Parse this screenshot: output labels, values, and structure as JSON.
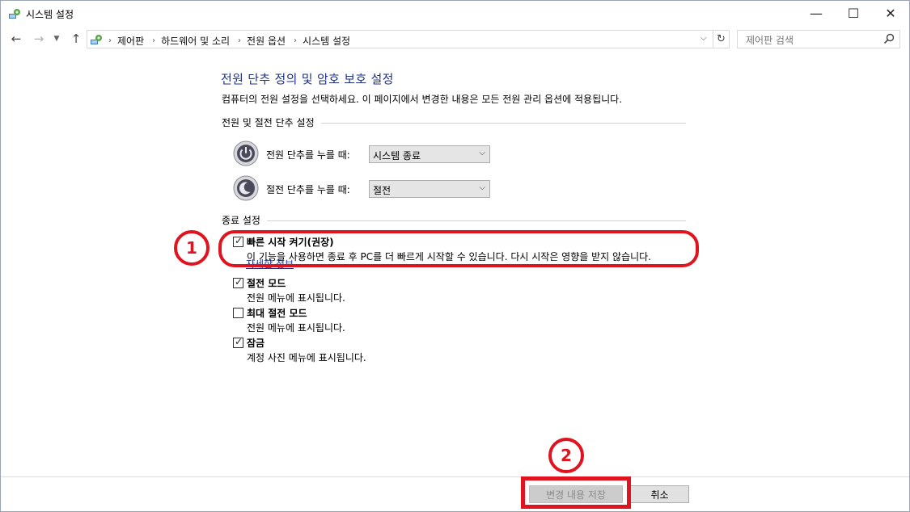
{
  "window": {
    "title": "시스템 설정",
    "controls": {
      "minimize": "—",
      "maximize": "☐",
      "close": "✕"
    }
  },
  "nav": {
    "back": "←",
    "forward": "→",
    "recent": "⌄",
    "up": "↑",
    "breadcrumb": [
      "제어판",
      "하드웨어 및 소리",
      "전원 옵션",
      "시스템 설정"
    ],
    "breadcrumb_separator": "›",
    "address_dropdown": "⌄",
    "refresh": "↻",
    "search_placeholder": "제어판 검색"
  },
  "main": {
    "heading": "전원 단추 정의 및 암호 보호 설정",
    "description": "컴퓨터의 전원 설정을 선택하세요. 이 페이지에서 변경한 내용은 모든 전원 관리 옵션에 적용됩니다.",
    "power_section_label": "전원 및 절전 단추 설정",
    "power_button": {
      "label": "전원 단추를 누를 때:",
      "value": "시스템 종료"
    },
    "sleep_button": {
      "label": "절전 단추를 누를 때:",
      "value": "절전"
    },
    "shutdown_section_label": "종료 설정",
    "options": [
      {
        "title": "빠른 시작 켜기(권장)",
        "description": "이 기능을 사용하면 종료 후 PC를 더 빠르게 시작할 수 있습니다. 다시 시작은 영향을 받지 않습니다.",
        "checked": true
      },
      {
        "title": "절전 모드",
        "description": "전원 메뉴에 표시됩니다.",
        "checked": true
      },
      {
        "title": "최대 절전 모드",
        "description": "전원 메뉴에 표시됩니다.",
        "checked": false
      },
      {
        "title": "잠금",
        "description": "계정 사진 메뉴에 표시됩니다.",
        "checked": true
      }
    ],
    "more_info_link": "자세한 정보",
    "check_mark": "✓"
  },
  "footer": {
    "save_label": "변경 내용 저장",
    "save_enabled": false,
    "cancel_label": "취소"
  },
  "annotations": {
    "marker_1": "1",
    "marker_2": "2",
    "color": "#e0141e"
  },
  "colors": {
    "heading": "#1e3287",
    "link": "#1e3287"
  },
  "icons": {
    "app": "control-panel-icon",
    "search": "search-icon",
    "power": "power-icon",
    "sleep": "sleep-icon",
    "checkbox": "checkbox-icon"
  }
}
